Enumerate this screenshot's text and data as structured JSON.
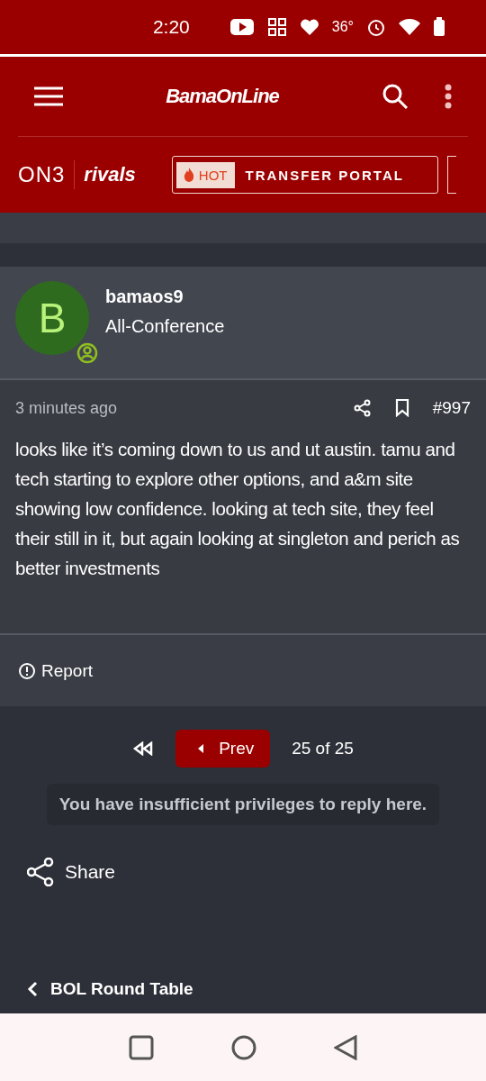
{
  "status_bar": {
    "time": "2:20",
    "temperature": "36°"
  },
  "header": {
    "logo": "BamaOnLine"
  },
  "brand_bar": {
    "on3_logo": "ON3",
    "rivals_logo": "rivals",
    "hot_badge": "HOT",
    "promo": "TRANSFER PORTAL"
  },
  "user": {
    "avatar_letter": "B",
    "name": "bamaos9",
    "rank": "All-Conference"
  },
  "post": {
    "time": "3 minutes ago",
    "number": "#997",
    "body": "looks like it’s coming down to us and ut austin. tamu and tech starting to explore other options, and a&m site showing low confidence. looking at tech site, they feel their still in it, but again looking at singleton and perich as better investments",
    "report": "Report"
  },
  "pagination": {
    "prev": "Prev",
    "page": "25 of 25"
  },
  "notice": "You have insufficient privileges to reply here.",
  "share": "Share",
  "breadcrumb": "BOL Round Table"
}
